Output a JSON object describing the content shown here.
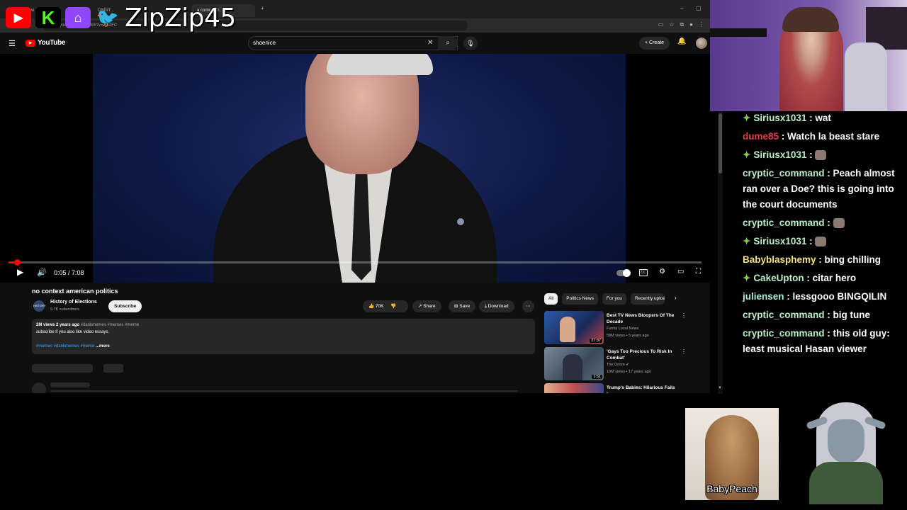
{
  "overlay": {
    "streamer_name": "ZipZip45"
  },
  "browser": {
    "tabs": [
      "Home / Twi",
      "OSINT...",
      "a contest ar..."
    ],
    "url": "youtube.com/watch?v=...14FC"
  },
  "youtube": {
    "logo_text": "YouTube",
    "search_value": "shoenice",
    "create_label": "Create",
    "player": {
      "time": "0:05 / 7:08",
      "progress": 0.012
    },
    "video": {
      "title": "no context american politics",
      "channel_name": "History of Elections",
      "channel_avatar_text": "HISTORY",
      "subscribers": "9.7K subscribers",
      "subscribe_label": "Subscribe",
      "likes": "70K",
      "share_label": "Share",
      "save_label": "Save",
      "download_label": "Download",
      "views": "2M views",
      "age": "2 years ago",
      "meta_tags": "#dankmemes #memes #meme",
      "description": "subscribe if you also like video essays.",
      "desc_tags": "#memes #dankmemes #meme",
      "more_label": "...more"
    },
    "chips": [
      "All",
      "Politics News",
      "For you",
      "Recently uploa"
    ],
    "recommendations": [
      {
        "title": "Best TV News Bloopers Of The Decade",
        "channel": "Funny Local News",
        "stats": "58M views • 5 years ago",
        "duration": "27:37"
      },
      {
        "title": "'Gays Too Precious To Risk In Combat'",
        "channel": "The Onion",
        "stats": "10M views • 17 years ago",
        "duration": "1:51"
      },
      {
        "title": "Trump's Babies: Hilarious Fails |",
        "channel": "",
        "stats": "",
        "duration": ""
      }
    ]
  },
  "chat": [
    {
      "user": "Siriusx1031",
      "color": "#b9f0c8",
      "badge": true,
      "text": "wat"
    },
    {
      "user": "dume85",
      "color": "#e63946",
      "badge": false,
      "text": "Watch la beast stare"
    },
    {
      "user": "Siriusx1031",
      "color": "#b9f0c8",
      "badge": true,
      "text": ""
    },
    {
      "user": "cryptic_command",
      "color": "#b9f0c8",
      "badge": false,
      "text": "Peach almost ran over a Doe? this is going into the court documents"
    },
    {
      "user": "cryptic_command",
      "color": "#b9f0c8",
      "badge": false,
      "text": ""
    },
    {
      "user": "Siriusx1031",
      "color": "#b9f0c8",
      "badge": true,
      "text": ""
    },
    {
      "user": "Babyblasphemy",
      "color": "#f5e27a",
      "badge": false,
      "text": "bing chilling"
    },
    {
      "user": "CakeUpton",
      "color": "#b9f0c8",
      "badge": true,
      "text": "citar hero"
    },
    {
      "user": "juliensen",
      "color": "#a8f0d8",
      "badge": false,
      "text": "lessgooo BINGQILIN"
    },
    {
      "user": "cryptic_command",
      "color": "#b9f0c8",
      "badge": false,
      "text": "big tune"
    },
    {
      "user": "cryptic_command",
      "color": "#b9f0c8",
      "badge": false,
      "text": "this old guy: least musical Hasan viewer"
    }
  ],
  "cams": {
    "guest_label": "BabyPeach"
  }
}
